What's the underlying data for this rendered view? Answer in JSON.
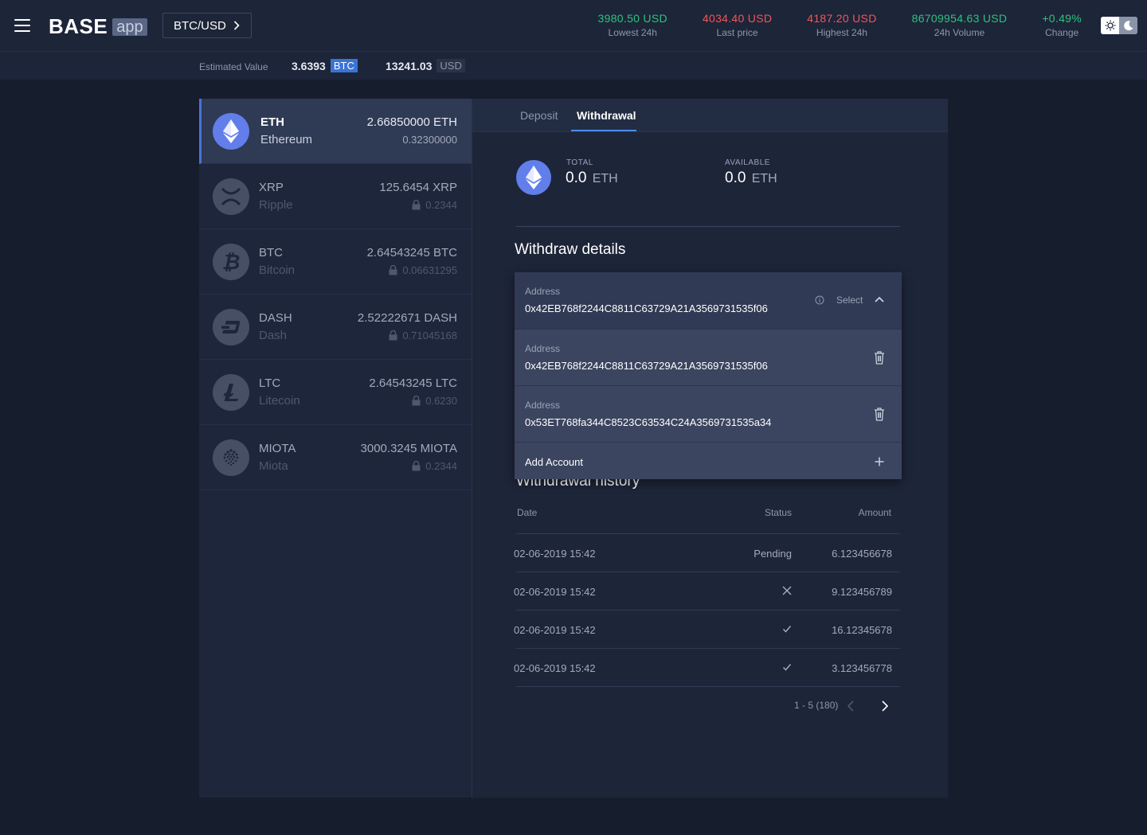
{
  "header": {
    "logo_text": "BASE",
    "logo_badge": "app",
    "pair": "BTC/USD",
    "stats": [
      {
        "value": "3980.50 USD",
        "label": "Lowest 24h",
        "color": "#2ec27e"
      },
      {
        "value": "4034.40 USD",
        "label": "Last price",
        "color": "#f0565a"
      },
      {
        "value": "4187.20 USD",
        "label": "Highest 24h",
        "color": "#f0565a"
      },
      {
        "value": "86709954.63 USD",
        "label": "24h Volume",
        "color": "#2ec27e"
      },
      {
        "value": "+0.49%",
        "label": "Change",
        "color": "#2ec27e"
      }
    ]
  },
  "estimate": {
    "label": "Estimated Value",
    "btc_value": "3.6393",
    "btc_unit": "BTC",
    "usd_value": "13241.03",
    "usd_unit": "USD"
  },
  "wallets": [
    {
      "symbol": "ETH",
      "name": "Ethereum",
      "balance": "2.66850000 ETH",
      "locked": "0.32300000",
      "icon": "ethereum-icon"
    },
    {
      "symbol": "XRP",
      "name": "Ripple",
      "balance": "125.6454 XRP",
      "locked": "0.2344",
      "icon": "ripple-icon"
    },
    {
      "symbol": "BTC",
      "name": "Bitcoin",
      "balance": "2.64543245 BTC",
      "locked": "0.06631295",
      "icon": "bitcoin-icon"
    },
    {
      "symbol": "DASH",
      "name": "Dash",
      "balance": "2.52222671 DASH",
      "locked": "0.71045168",
      "icon": "dash-icon"
    },
    {
      "symbol": "LTC",
      "name": "Litecoin",
      "balance": "2.64543245 LTC",
      "locked": "0.6230",
      "icon": "litecoin-icon"
    },
    {
      "symbol": "MIOTA",
      "name": "Miota",
      "balance": "3000.3245 MIOTA",
      "locked": "0.2344",
      "icon": "iota-icon"
    }
  ],
  "tabs": {
    "deposit": "Deposit",
    "withdrawal": "Withdrawal"
  },
  "summary": {
    "total_label": "TOTAL",
    "total_value": "0.0",
    "total_unit": "ETH",
    "available_label": "AVAILABLE",
    "available_value": "0.0",
    "available_unit": "ETH"
  },
  "withdraw": {
    "title": "Withdraw details",
    "address_label": "Address",
    "selected_address": "0x42EB768f2244C8811C63729A21A3569731535f06",
    "select_label": "Select",
    "options": [
      {
        "label": "Address",
        "address": "0x42EB768f2244C8811C63729A21A3569731535f06"
      },
      {
        "label": "Address",
        "address": "0x53ET768fa344C8523C63534C24A3569731535a34"
      }
    ],
    "add_account": "Add Account"
  },
  "history": {
    "title": "Withdrawal history",
    "columns": {
      "date": "Date",
      "status": "Status",
      "amount": "Amount"
    },
    "rows": [
      {
        "date": "02-06-2019 15:42",
        "status": "Pending",
        "amount": "6.123456678"
      },
      {
        "date": "02-06-2019 15:42",
        "status": "",
        "status_icon": "close-icon",
        "amount": "9.123456789"
      },
      {
        "date": "02-06-2019 15:42",
        "status": "",
        "status_icon": "check-icon",
        "amount": "16.12345678"
      },
      {
        "date": "02-06-2019 15:42",
        "status": "",
        "status_icon": "check-icon",
        "amount": "3.123456778"
      }
    ],
    "pagination": "1 - 5 (180)"
  }
}
